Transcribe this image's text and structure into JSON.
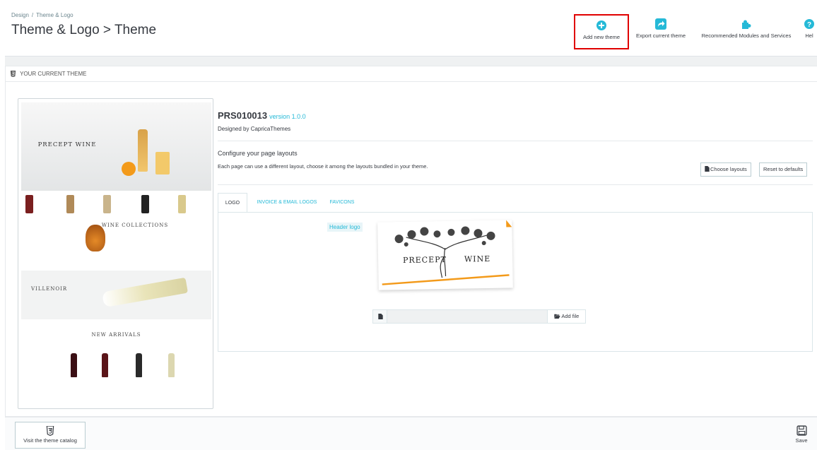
{
  "breadcrumb": [
    "Design",
    "Theme & Logo"
  ],
  "page_title": "Theme & Logo > Theme",
  "toolbar": {
    "add_new_theme": "Add new theme",
    "export_current_theme": "Export current theme",
    "recommended_modules": "Recommended Modules and Services",
    "help": "Hel"
  },
  "panel": {
    "heading": "YOUR CURRENT THEME"
  },
  "preview": {
    "brand_text": "PRECEPT WINE",
    "collections_text": "WINE COLLECTIONS",
    "villenoir_text": "VILLENOIR",
    "new_arrivals_text": "NEW ARRIVALS"
  },
  "theme": {
    "name": "PRS010013",
    "version": "version 1.0.0",
    "designed_by": "Designed by CapricaThemes"
  },
  "layouts": {
    "title": "Configure your page layouts",
    "description": "Each page can use a different layout, choose it among the layouts bundled in your theme.",
    "choose_layouts": "Choose layouts",
    "reset_defaults": "Reset to defaults"
  },
  "tabs": [
    {
      "label": "LOGO",
      "active": true
    },
    {
      "label": "INVOICE & EMAIL LOGOS",
      "active": false
    },
    {
      "label": "FAVICONS",
      "active": false
    }
  ],
  "logo_tab": {
    "header_logo_label": "Header logo",
    "logo_text_left": "PRECEPT",
    "logo_text_right": "WINE",
    "add_file": "Add file"
  },
  "footer": {
    "visit_catalog": "Visit the theme catalog",
    "save": "Save"
  },
  "colors": {
    "accent": "#25b9d7",
    "highlight": "#e00000",
    "logo_orange": "#f39a1a"
  },
  "icons": {
    "add_new_theme": "plus-circle-icon",
    "export": "share-icon",
    "recommended": "puzzle-icon",
    "help": "question-icon",
    "panel": "html5-icon",
    "choose_layouts": "file-icon",
    "add_file": "folder-open-icon",
    "catalog": "html5-icon",
    "save": "save-icon"
  }
}
